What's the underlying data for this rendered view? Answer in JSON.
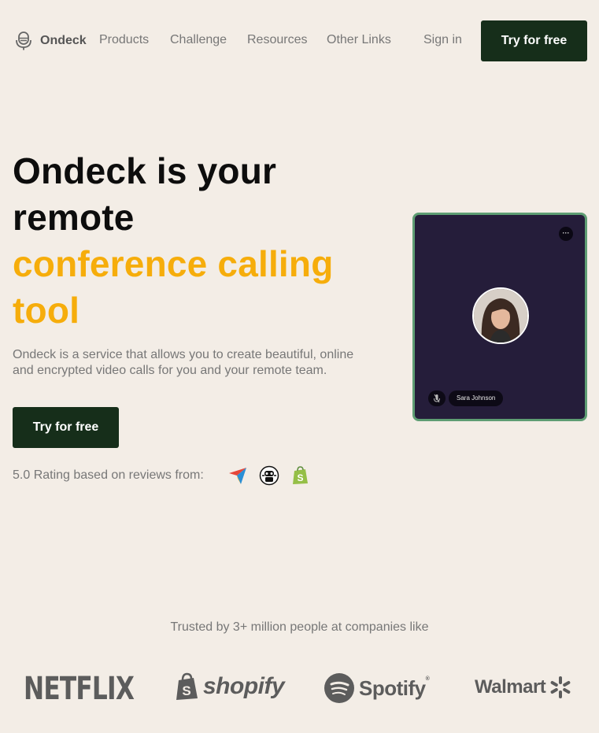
{
  "nav": {
    "brand": "Ondeck",
    "links": [
      "Products",
      "Challenge",
      "Resources",
      "Other Links"
    ],
    "sign_in": "Sign in",
    "cta": "Try for free"
  },
  "hero": {
    "title_line1": "Ondeck is your",
    "title_line2": "remote",
    "title_accent1": "conference calling",
    "title_accent2": "tool",
    "description": "Ondeck is a service that allows you to create beautiful, online and encrypted video calls for you and your remote team.",
    "cta": "Try for free",
    "rating_text": "5.0 Rating based on reviews from:",
    "review_sources": [
      "paper-plane-logo",
      "robot-badge-logo",
      "shopify-bag-logo"
    ]
  },
  "video_card": {
    "participant_name": "Sara Johnson",
    "more_label": "···",
    "mute_icon": "mic-off-icon"
  },
  "trusted": {
    "text": "Trusted by 3+ million people at companies like",
    "brands": [
      "NETFLIX",
      "shopify",
      "Spotify",
      "Walmart"
    ]
  },
  "colors": {
    "background": "#f3ede6",
    "accent": "#f6ad0b",
    "button": "#162e1a",
    "card": "#251d3a",
    "card_border": "#5e9d73"
  }
}
